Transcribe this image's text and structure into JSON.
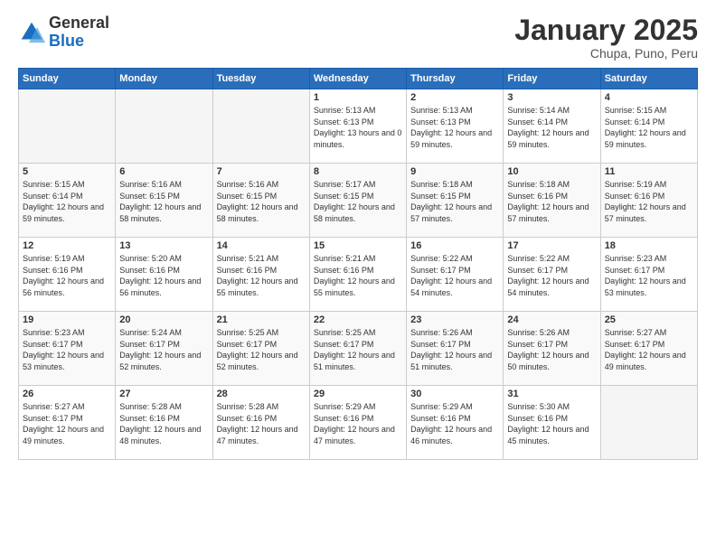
{
  "logo": {
    "general": "General",
    "blue": "Blue"
  },
  "header": {
    "title": "January 2025",
    "subtitle": "Chupa, Puno, Peru"
  },
  "days_of_week": [
    "Sunday",
    "Monday",
    "Tuesday",
    "Wednesday",
    "Thursday",
    "Friday",
    "Saturday"
  ],
  "weeks": [
    [
      {
        "day": "",
        "info": ""
      },
      {
        "day": "",
        "info": ""
      },
      {
        "day": "",
        "info": ""
      },
      {
        "day": "1",
        "info": "Sunrise: 5:13 AM\nSunset: 6:13 PM\nDaylight: 13 hours\nand 0 minutes."
      },
      {
        "day": "2",
        "info": "Sunrise: 5:13 AM\nSunset: 6:13 PM\nDaylight: 12 hours\nand 59 minutes."
      },
      {
        "day": "3",
        "info": "Sunrise: 5:14 AM\nSunset: 6:14 PM\nDaylight: 12 hours\nand 59 minutes."
      },
      {
        "day": "4",
        "info": "Sunrise: 5:15 AM\nSunset: 6:14 PM\nDaylight: 12 hours\nand 59 minutes."
      }
    ],
    [
      {
        "day": "5",
        "info": "Sunrise: 5:15 AM\nSunset: 6:14 PM\nDaylight: 12 hours\nand 59 minutes."
      },
      {
        "day": "6",
        "info": "Sunrise: 5:16 AM\nSunset: 6:15 PM\nDaylight: 12 hours\nand 58 minutes."
      },
      {
        "day": "7",
        "info": "Sunrise: 5:16 AM\nSunset: 6:15 PM\nDaylight: 12 hours\nand 58 minutes."
      },
      {
        "day": "8",
        "info": "Sunrise: 5:17 AM\nSunset: 6:15 PM\nDaylight: 12 hours\nand 58 minutes."
      },
      {
        "day": "9",
        "info": "Sunrise: 5:18 AM\nSunset: 6:15 PM\nDaylight: 12 hours\nand 57 minutes."
      },
      {
        "day": "10",
        "info": "Sunrise: 5:18 AM\nSunset: 6:16 PM\nDaylight: 12 hours\nand 57 minutes."
      },
      {
        "day": "11",
        "info": "Sunrise: 5:19 AM\nSunset: 6:16 PM\nDaylight: 12 hours\nand 57 minutes."
      }
    ],
    [
      {
        "day": "12",
        "info": "Sunrise: 5:19 AM\nSunset: 6:16 PM\nDaylight: 12 hours\nand 56 minutes."
      },
      {
        "day": "13",
        "info": "Sunrise: 5:20 AM\nSunset: 6:16 PM\nDaylight: 12 hours\nand 56 minutes."
      },
      {
        "day": "14",
        "info": "Sunrise: 5:21 AM\nSunset: 6:16 PM\nDaylight: 12 hours\nand 55 minutes."
      },
      {
        "day": "15",
        "info": "Sunrise: 5:21 AM\nSunset: 6:16 PM\nDaylight: 12 hours\nand 55 minutes."
      },
      {
        "day": "16",
        "info": "Sunrise: 5:22 AM\nSunset: 6:17 PM\nDaylight: 12 hours\nand 54 minutes."
      },
      {
        "day": "17",
        "info": "Sunrise: 5:22 AM\nSunset: 6:17 PM\nDaylight: 12 hours\nand 54 minutes."
      },
      {
        "day": "18",
        "info": "Sunrise: 5:23 AM\nSunset: 6:17 PM\nDaylight: 12 hours\nand 53 minutes."
      }
    ],
    [
      {
        "day": "19",
        "info": "Sunrise: 5:23 AM\nSunset: 6:17 PM\nDaylight: 12 hours\nand 53 minutes."
      },
      {
        "day": "20",
        "info": "Sunrise: 5:24 AM\nSunset: 6:17 PM\nDaylight: 12 hours\nand 52 minutes."
      },
      {
        "day": "21",
        "info": "Sunrise: 5:25 AM\nSunset: 6:17 PM\nDaylight: 12 hours\nand 52 minutes."
      },
      {
        "day": "22",
        "info": "Sunrise: 5:25 AM\nSunset: 6:17 PM\nDaylight: 12 hours\nand 51 minutes."
      },
      {
        "day": "23",
        "info": "Sunrise: 5:26 AM\nSunset: 6:17 PM\nDaylight: 12 hours\nand 51 minutes."
      },
      {
        "day": "24",
        "info": "Sunrise: 5:26 AM\nSunset: 6:17 PM\nDaylight: 12 hours\nand 50 minutes."
      },
      {
        "day": "25",
        "info": "Sunrise: 5:27 AM\nSunset: 6:17 PM\nDaylight: 12 hours\nand 49 minutes."
      }
    ],
    [
      {
        "day": "26",
        "info": "Sunrise: 5:27 AM\nSunset: 6:17 PM\nDaylight: 12 hours\nand 49 minutes."
      },
      {
        "day": "27",
        "info": "Sunrise: 5:28 AM\nSunset: 6:16 PM\nDaylight: 12 hours\nand 48 minutes."
      },
      {
        "day": "28",
        "info": "Sunrise: 5:28 AM\nSunset: 6:16 PM\nDaylight: 12 hours\nand 47 minutes."
      },
      {
        "day": "29",
        "info": "Sunrise: 5:29 AM\nSunset: 6:16 PM\nDaylight: 12 hours\nand 47 minutes."
      },
      {
        "day": "30",
        "info": "Sunrise: 5:29 AM\nSunset: 6:16 PM\nDaylight: 12 hours\nand 46 minutes."
      },
      {
        "day": "31",
        "info": "Sunrise: 5:30 AM\nSunset: 6:16 PM\nDaylight: 12 hours\nand 45 minutes."
      },
      {
        "day": "",
        "info": ""
      }
    ]
  ]
}
